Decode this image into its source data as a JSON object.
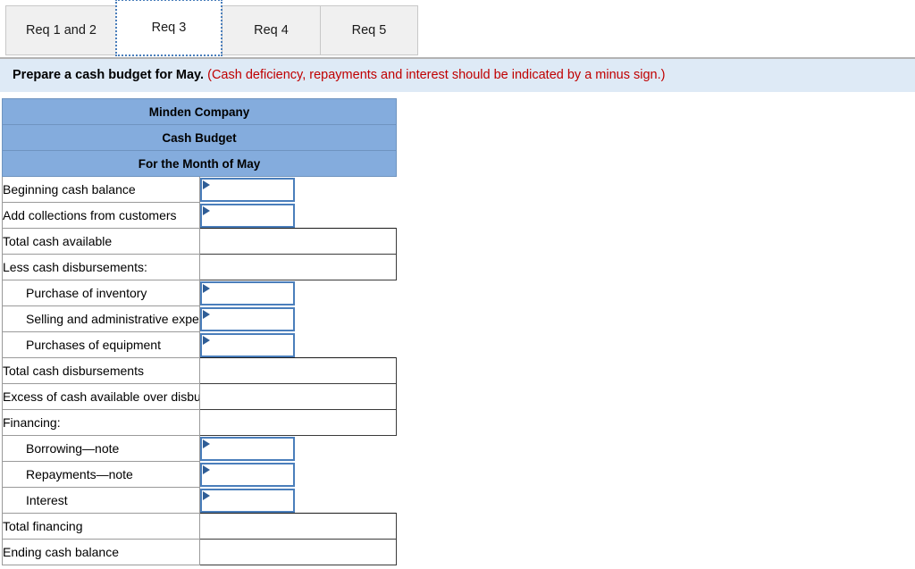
{
  "tabs": [
    {
      "label": "Req 1 and 2",
      "name": "tab-req-1-and-2",
      "active": false
    },
    {
      "label": "Req 3",
      "name": "tab-req-3",
      "active": true
    },
    {
      "label": "Req 4",
      "name": "tab-req-4",
      "active": false
    },
    {
      "label": "Req 5",
      "name": "tab-req-5",
      "active": false
    }
  ],
  "instruction": {
    "lead": "Prepare a cash budget for May.",
    "note": "(Cash deficiency, repayments and interest should be indicated by a minus sign.)"
  },
  "table": {
    "header": {
      "company": "Minden Company",
      "statement": "Cash Budget",
      "period": "For the Month of May"
    },
    "rows": [
      {
        "label": "Beginning cash balance",
        "indent": false,
        "input": true,
        "value": ""
      },
      {
        "label": "Add collections from customers",
        "indent": false,
        "input": true,
        "value": ""
      },
      {
        "label": "Total cash available",
        "indent": false,
        "input": false,
        "value": ""
      },
      {
        "label": "Less cash disbursements:",
        "indent": false,
        "input": false,
        "value": ""
      },
      {
        "label": "Purchase of inventory",
        "indent": true,
        "input": true,
        "value": ""
      },
      {
        "label": "Selling and administrative expenses",
        "indent": true,
        "input": true,
        "value": ""
      },
      {
        "label": "Purchases of equipment",
        "indent": true,
        "input": true,
        "value": ""
      },
      {
        "label": "Total cash disbursements",
        "indent": false,
        "input": false,
        "value": ""
      },
      {
        "label": "Excess of cash available over disbursements",
        "indent": false,
        "input": false,
        "value": ""
      },
      {
        "label": "Financing:",
        "indent": false,
        "input": false,
        "value": ""
      },
      {
        "label": "Borrowing—note",
        "indent": true,
        "input": true,
        "value": ""
      },
      {
        "label": "Repayments—note",
        "indent": true,
        "input": true,
        "value": ""
      },
      {
        "label": "Interest",
        "indent": true,
        "input": true,
        "value": ""
      },
      {
        "label": "Total financing",
        "indent": false,
        "input": false,
        "value": ""
      },
      {
        "label": "Ending cash balance",
        "indent": false,
        "input": false,
        "value": ""
      }
    ]
  },
  "colors": {
    "header_band": "#84acdd",
    "instruction_bg": "#deeaf6",
    "note_text": "#c00000",
    "input_border": "#4a7ebb",
    "input_marker": "#2f5d96",
    "tab_inactive_bg": "#f0f0f0"
  },
  "icons": {
    "cell_marker": "triangle-right-marker-icon"
  }
}
